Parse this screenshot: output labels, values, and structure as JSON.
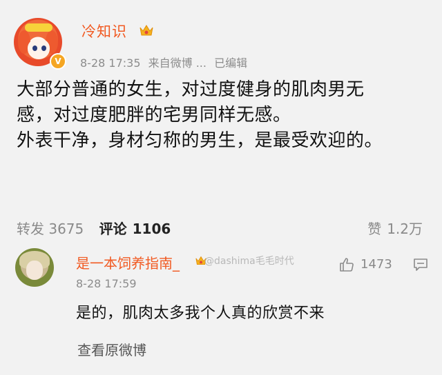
{
  "post": {
    "username": "冷知识",
    "verified_badge": "V",
    "time": "8-28 17:35",
    "source": "来自微博 ...",
    "edited": "已编辑",
    "content_lines": [
      "大部分普通的女生，对过度健身的肌肉男无",
      "感，对过度肥胖的宅男同样无感。",
      "外表干净，身材匀称的男生，是最受欢迎的。"
    ],
    "repost_label": "转发",
    "repost_count": "3675",
    "comment_label": "评论",
    "comment_count": "1106",
    "like_label": "赞",
    "like_count": "1.2万"
  },
  "comment": {
    "username": "是一本饲养指南_",
    "watermark": "@dashima毛毛时代",
    "time": "8-28 17:59",
    "text": "是的，肌肉太多我个人真的欣赏不来",
    "like_count": "1473"
  },
  "footer": {
    "view_original": "查看原微博"
  },
  "icons": {
    "crown": "crown-icon",
    "verified": "verified-badge-icon",
    "like": "thumbs-up-icon",
    "reply": "comment-reply-icon"
  },
  "colors": {
    "username": "#f15a22",
    "meta": "#8c8c8c",
    "background": "#f2f2f2"
  }
}
